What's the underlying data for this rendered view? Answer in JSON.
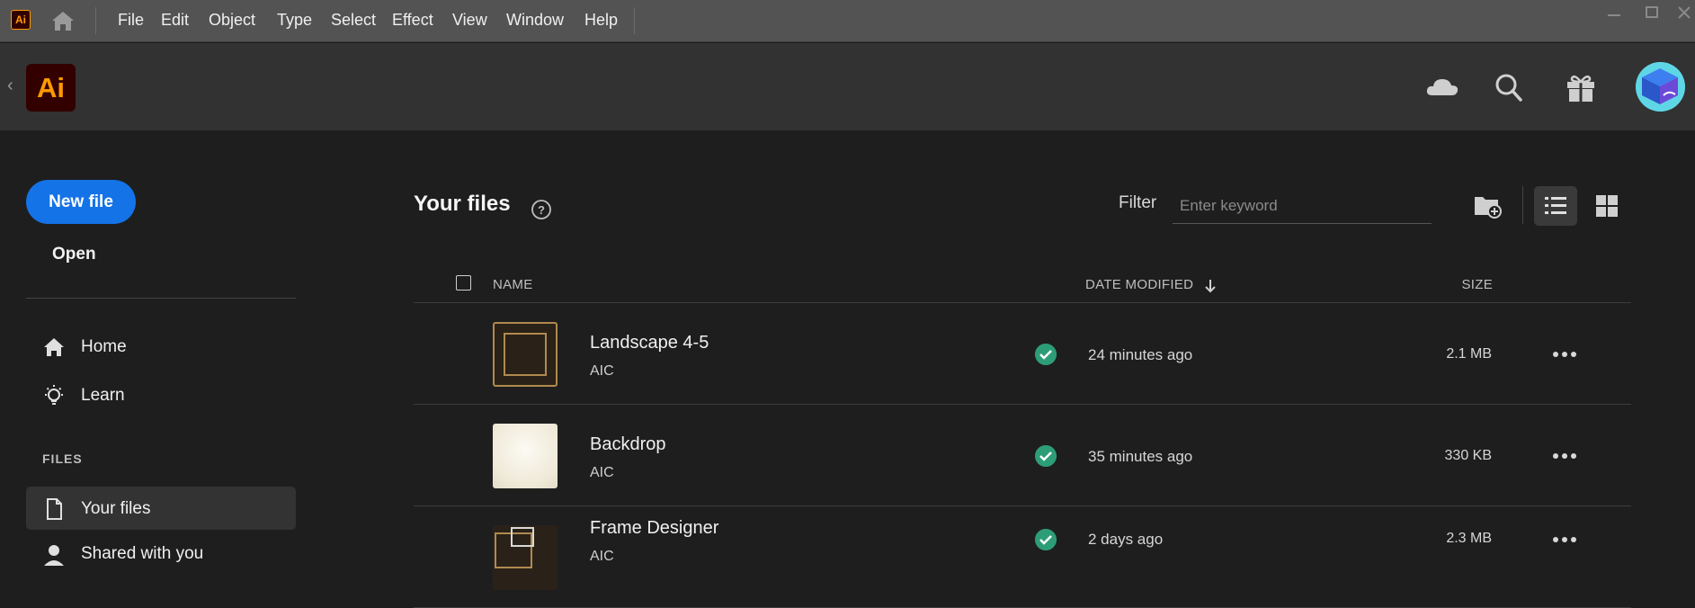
{
  "menubar": {
    "app_logo": "Ai",
    "items": [
      "File",
      "Edit",
      "Object",
      "Type",
      "Select",
      "Effect",
      "View",
      "Window",
      "Help"
    ]
  },
  "appbar": {
    "logo": "Ai"
  },
  "sidebar": {
    "new_file": "New file",
    "open": "Open",
    "nav": [
      {
        "label": "Home",
        "icon": "home-icon"
      },
      {
        "label": "Learn",
        "icon": "lightbulb-icon"
      }
    ],
    "files_section": "FILES",
    "files_nav": [
      {
        "label": "Your files",
        "icon": "document-icon",
        "active": true
      },
      {
        "label": "Shared with you",
        "icon": "user-icon"
      }
    ]
  },
  "main": {
    "title": "Your files",
    "filter_label": "Filter",
    "filter_placeholder": "Enter keyword",
    "columns": {
      "name": "NAME",
      "date": "DATE MODIFIED",
      "size": "SIZE"
    },
    "files": [
      {
        "name": "Landscape 4-5",
        "type": "AIC",
        "modified": "24 minutes ago",
        "size": "2.1 MB"
      },
      {
        "name": "Backdrop",
        "type": "AIC",
        "modified": "35 minutes ago",
        "size": "330 KB"
      },
      {
        "name": "Frame Designer",
        "type": "AIC",
        "modified": "2 days ago",
        "size": "2.3 MB"
      }
    ]
  },
  "colors": {
    "accent": "#1473e6",
    "ai_orange": "#ff9a00",
    "ai_bg": "#330000",
    "synced_green": "#2d9d78"
  }
}
